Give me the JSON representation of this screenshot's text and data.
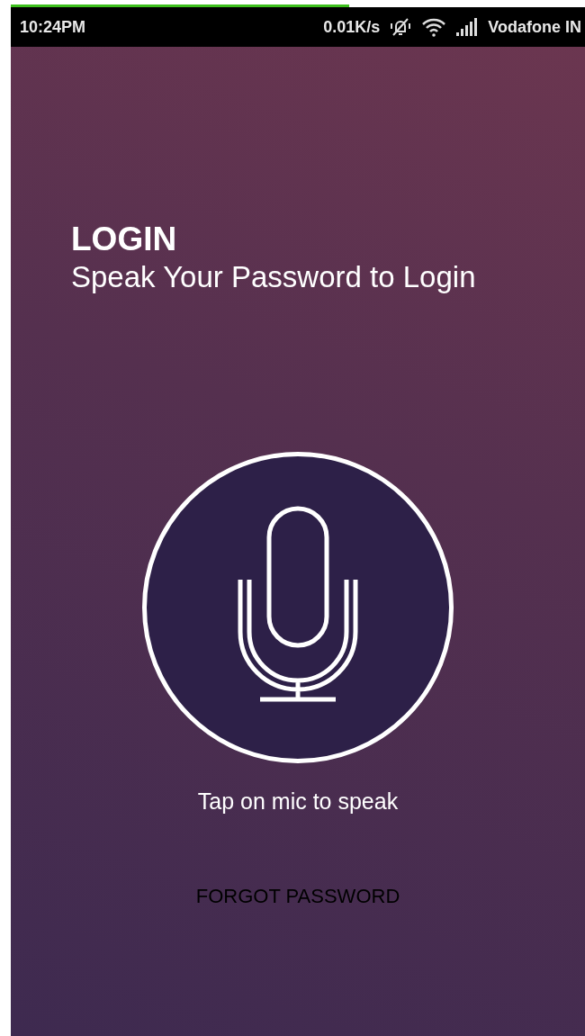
{
  "load_progress": {
    "level": 0.59
  },
  "status_bar": {
    "time": "10:24PM",
    "speed": "0.01K/s",
    "carrier": "Vodafone IN"
  },
  "login": {
    "title": "LOGIN",
    "subtitle": "Speak Your Password to Login",
    "hint": "Tap on mic to speak",
    "forgot_link": "FORGOT PASSWORD"
  }
}
